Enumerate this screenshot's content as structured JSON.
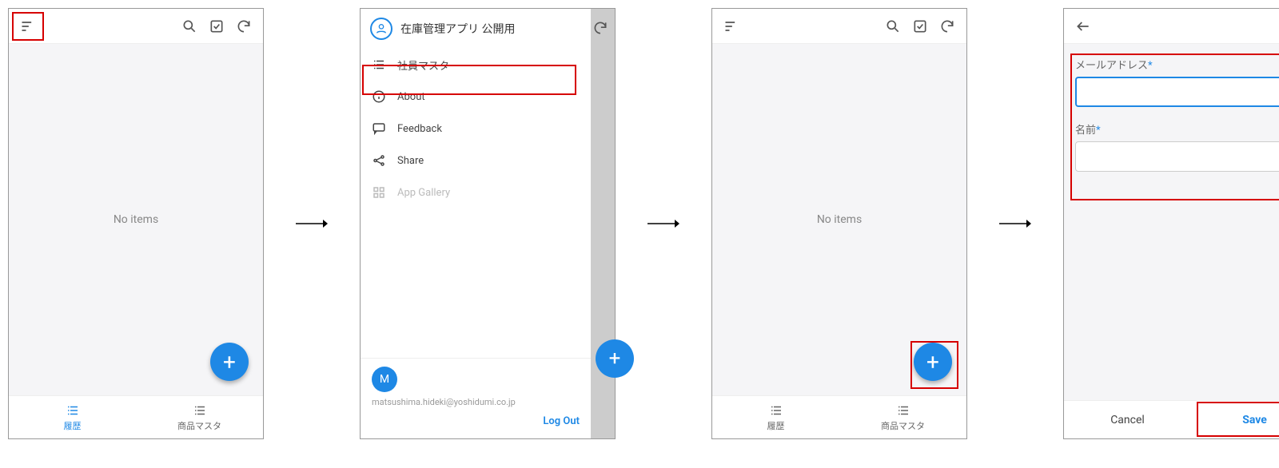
{
  "screen1": {
    "empty_text": "No items",
    "tabs": [
      {
        "label": "履歴",
        "active": true
      },
      {
        "label": "商品マスタ",
        "active": false
      }
    ]
  },
  "screen2": {
    "app_title": "在庫管理アプリ 公開用",
    "menu": {
      "employee_master": "社員マスタ",
      "about": "About",
      "feedback": "Feedback",
      "share": "Share",
      "app_gallery": "App Gallery"
    },
    "user": {
      "initial": "M",
      "email": "matsushima.hideki@yoshidumi.co.jp"
    },
    "logout_label": "Log Out"
  },
  "screen3": {
    "empty_text": "No items",
    "tabs": [
      {
        "label": "履歴",
        "active": false
      },
      {
        "label": "商品マスタ",
        "active": false
      }
    ]
  },
  "screen4": {
    "fields": {
      "email_label": "メールアドレス",
      "name_label": "名前"
    },
    "actions": {
      "cancel": "Cancel",
      "save": "Save"
    }
  }
}
